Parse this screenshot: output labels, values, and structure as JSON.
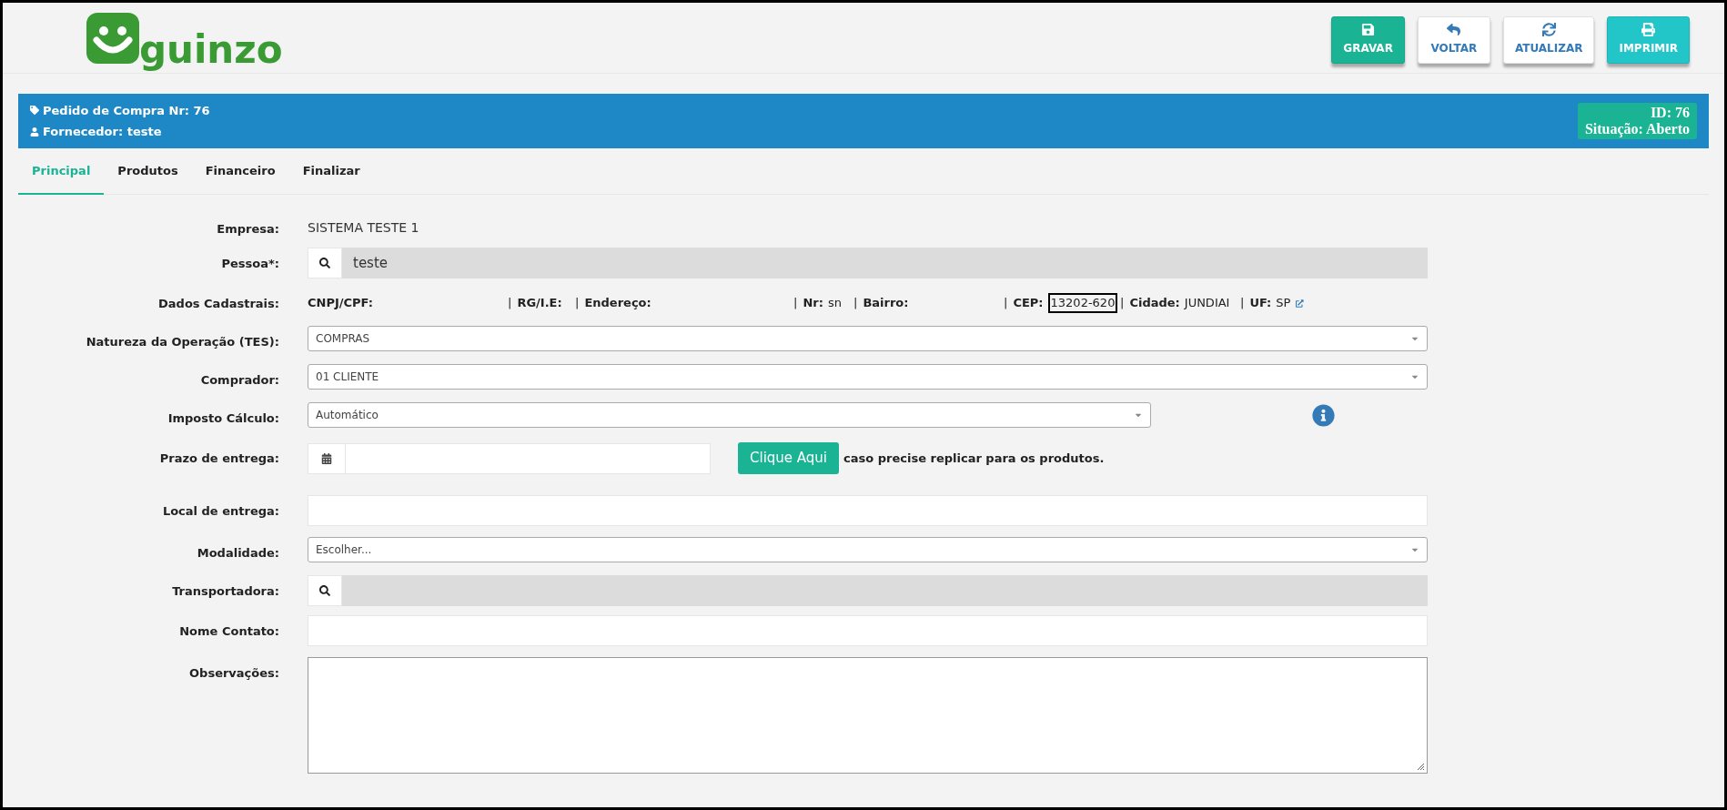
{
  "logo": {
    "text": "guinzo"
  },
  "toolbar": [
    {
      "label": "GRAVAR",
      "kind": "save"
    },
    {
      "label": "VOLTAR",
      "kind": "back"
    },
    {
      "label": "ATUALIZAR",
      "kind": "refresh"
    },
    {
      "label": "IMPRIMIR",
      "kind": "print"
    }
  ],
  "order_bar": {
    "title": "Pedido de Compra Nr: 76",
    "supplier": "Fornecedor: teste",
    "id": "ID: 76",
    "status": "Situação: Aberto"
  },
  "tabs": [
    {
      "label": "Principal",
      "selected": true
    },
    {
      "label": "Produtos",
      "selected": false
    },
    {
      "label": "Financeiro",
      "selected": false
    },
    {
      "label": "Finalizar",
      "selected": false
    }
  ],
  "form": [
    {
      "label": "Empresa:",
      "kind": "text",
      "value": "SISTEMA TESTE 1"
    },
    {
      "label": "Pessoa*:",
      "kind": "lookup",
      "value": "teste"
    },
    {
      "label": "Dados Cadastrais:",
      "kind": "details"
    },
    {
      "label": "Natureza da Operação (TES):",
      "kind": "select",
      "value": "COMPRAS"
    },
    {
      "label": "Comprador:",
      "kind": "select",
      "value": "01 CLIENTE"
    },
    {
      "label": "Imposto Cálculo:",
      "kind": "select-info",
      "value": "Automático"
    },
    {
      "label": "Prazo de entrega:",
      "kind": "date",
      "button": "Clique Aqui",
      "hint": "caso precise replicar para os produtos."
    },
    {
      "label": "Local de entrega:",
      "kind": "input"
    },
    {
      "label": "Modalidade:",
      "kind": "select",
      "value": "Escolher..."
    },
    {
      "label": "Transportadora:",
      "kind": "lookup"
    },
    {
      "label": "Nome Contato:",
      "kind": "input"
    },
    {
      "label": "Observações:",
      "kind": "textarea"
    }
  ],
  "details": {
    "separator": "|",
    "items": [
      {
        "label": "CNPJ/CPF:"
      },
      {
        "label": "RG/I.E:"
      },
      {
        "label": "Endereço:"
      },
      {
        "label": "Nr:",
        "value": "sn"
      },
      {
        "label": "Bairro:"
      },
      {
        "label": "CEP:",
        "value": "13202-620",
        "highlighted": true
      },
      {
        "label": "Cidade:",
        "value": "JUNDIAI"
      },
      {
        "label": "UF:",
        "value": "SP"
      }
    ]
  }
}
